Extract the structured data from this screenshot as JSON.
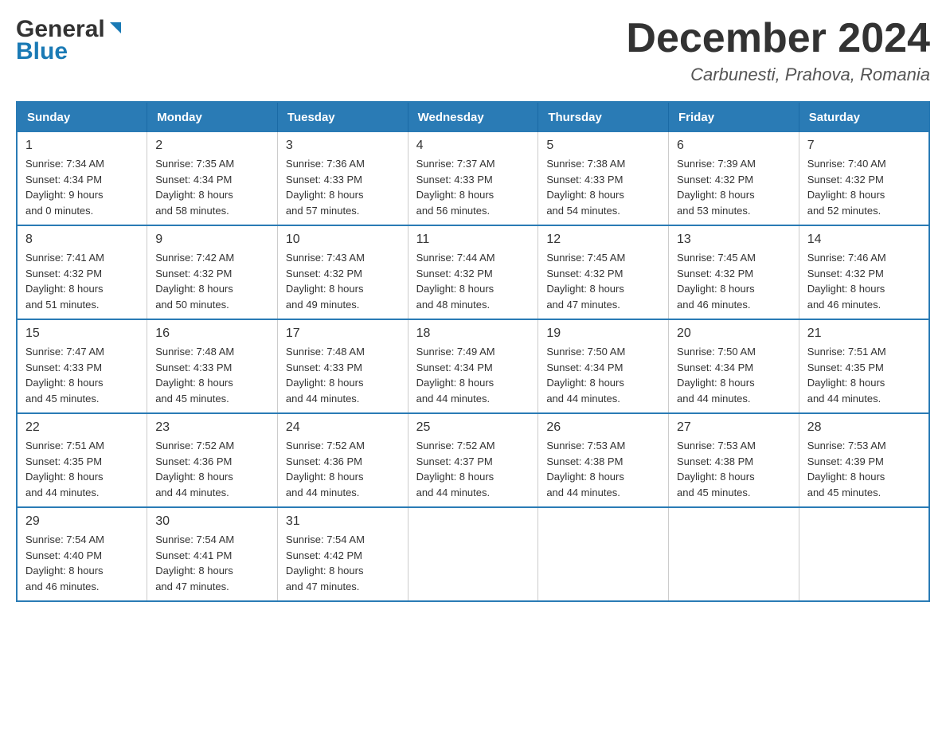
{
  "header": {
    "logo_general": "General",
    "logo_blue": "Blue",
    "month_title": "December 2024",
    "location": "Carbunesti, Prahova, Romania"
  },
  "days_of_week": [
    "Sunday",
    "Monday",
    "Tuesday",
    "Wednesday",
    "Thursday",
    "Friday",
    "Saturday"
  ],
  "weeks": [
    [
      {
        "day": "1",
        "sunrise": "Sunrise: 7:34 AM",
        "sunset": "Sunset: 4:34 PM",
        "daylight": "Daylight: 9 hours",
        "daylight2": "and 0 minutes."
      },
      {
        "day": "2",
        "sunrise": "Sunrise: 7:35 AM",
        "sunset": "Sunset: 4:34 PM",
        "daylight": "Daylight: 8 hours",
        "daylight2": "and 58 minutes."
      },
      {
        "day": "3",
        "sunrise": "Sunrise: 7:36 AM",
        "sunset": "Sunset: 4:33 PM",
        "daylight": "Daylight: 8 hours",
        "daylight2": "and 57 minutes."
      },
      {
        "day": "4",
        "sunrise": "Sunrise: 7:37 AM",
        "sunset": "Sunset: 4:33 PM",
        "daylight": "Daylight: 8 hours",
        "daylight2": "and 56 minutes."
      },
      {
        "day": "5",
        "sunrise": "Sunrise: 7:38 AM",
        "sunset": "Sunset: 4:33 PM",
        "daylight": "Daylight: 8 hours",
        "daylight2": "and 54 minutes."
      },
      {
        "day": "6",
        "sunrise": "Sunrise: 7:39 AM",
        "sunset": "Sunset: 4:32 PM",
        "daylight": "Daylight: 8 hours",
        "daylight2": "and 53 minutes."
      },
      {
        "day": "7",
        "sunrise": "Sunrise: 7:40 AM",
        "sunset": "Sunset: 4:32 PM",
        "daylight": "Daylight: 8 hours",
        "daylight2": "and 52 minutes."
      }
    ],
    [
      {
        "day": "8",
        "sunrise": "Sunrise: 7:41 AM",
        "sunset": "Sunset: 4:32 PM",
        "daylight": "Daylight: 8 hours",
        "daylight2": "and 51 minutes."
      },
      {
        "day": "9",
        "sunrise": "Sunrise: 7:42 AM",
        "sunset": "Sunset: 4:32 PM",
        "daylight": "Daylight: 8 hours",
        "daylight2": "and 50 minutes."
      },
      {
        "day": "10",
        "sunrise": "Sunrise: 7:43 AM",
        "sunset": "Sunset: 4:32 PM",
        "daylight": "Daylight: 8 hours",
        "daylight2": "and 49 minutes."
      },
      {
        "day": "11",
        "sunrise": "Sunrise: 7:44 AM",
        "sunset": "Sunset: 4:32 PM",
        "daylight": "Daylight: 8 hours",
        "daylight2": "and 48 minutes."
      },
      {
        "day": "12",
        "sunrise": "Sunrise: 7:45 AM",
        "sunset": "Sunset: 4:32 PM",
        "daylight": "Daylight: 8 hours",
        "daylight2": "and 47 minutes."
      },
      {
        "day": "13",
        "sunrise": "Sunrise: 7:45 AM",
        "sunset": "Sunset: 4:32 PM",
        "daylight": "Daylight: 8 hours",
        "daylight2": "and 46 minutes."
      },
      {
        "day": "14",
        "sunrise": "Sunrise: 7:46 AM",
        "sunset": "Sunset: 4:32 PM",
        "daylight": "Daylight: 8 hours",
        "daylight2": "and 46 minutes."
      }
    ],
    [
      {
        "day": "15",
        "sunrise": "Sunrise: 7:47 AM",
        "sunset": "Sunset: 4:33 PM",
        "daylight": "Daylight: 8 hours",
        "daylight2": "and 45 minutes."
      },
      {
        "day": "16",
        "sunrise": "Sunrise: 7:48 AM",
        "sunset": "Sunset: 4:33 PM",
        "daylight": "Daylight: 8 hours",
        "daylight2": "and 45 minutes."
      },
      {
        "day": "17",
        "sunrise": "Sunrise: 7:48 AM",
        "sunset": "Sunset: 4:33 PM",
        "daylight": "Daylight: 8 hours",
        "daylight2": "and 44 minutes."
      },
      {
        "day": "18",
        "sunrise": "Sunrise: 7:49 AM",
        "sunset": "Sunset: 4:34 PM",
        "daylight": "Daylight: 8 hours",
        "daylight2": "and 44 minutes."
      },
      {
        "day": "19",
        "sunrise": "Sunrise: 7:50 AM",
        "sunset": "Sunset: 4:34 PM",
        "daylight": "Daylight: 8 hours",
        "daylight2": "and 44 minutes."
      },
      {
        "day": "20",
        "sunrise": "Sunrise: 7:50 AM",
        "sunset": "Sunset: 4:34 PM",
        "daylight": "Daylight: 8 hours",
        "daylight2": "and 44 minutes."
      },
      {
        "day": "21",
        "sunrise": "Sunrise: 7:51 AM",
        "sunset": "Sunset: 4:35 PM",
        "daylight": "Daylight: 8 hours",
        "daylight2": "and 44 minutes."
      }
    ],
    [
      {
        "day": "22",
        "sunrise": "Sunrise: 7:51 AM",
        "sunset": "Sunset: 4:35 PM",
        "daylight": "Daylight: 8 hours",
        "daylight2": "and 44 minutes."
      },
      {
        "day": "23",
        "sunrise": "Sunrise: 7:52 AM",
        "sunset": "Sunset: 4:36 PM",
        "daylight": "Daylight: 8 hours",
        "daylight2": "and 44 minutes."
      },
      {
        "day": "24",
        "sunrise": "Sunrise: 7:52 AM",
        "sunset": "Sunset: 4:36 PM",
        "daylight": "Daylight: 8 hours",
        "daylight2": "and 44 minutes."
      },
      {
        "day": "25",
        "sunrise": "Sunrise: 7:52 AM",
        "sunset": "Sunset: 4:37 PM",
        "daylight": "Daylight: 8 hours",
        "daylight2": "and 44 minutes."
      },
      {
        "day": "26",
        "sunrise": "Sunrise: 7:53 AM",
        "sunset": "Sunset: 4:38 PM",
        "daylight": "Daylight: 8 hours",
        "daylight2": "and 44 minutes."
      },
      {
        "day": "27",
        "sunrise": "Sunrise: 7:53 AM",
        "sunset": "Sunset: 4:38 PM",
        "daylight": "Daylight: 8 hours",
        "daylight2": "and 45 minutes."
      },
      {
        "day": "28",
        "sunrise": "Sunrise: 7:53 AM",
        "sunset": "Sunset: 4:39 PM",
        "daylight": "Daylight: 8 hours",
        "daylight2": "and 45 minutes."
      }
    ],
    [
      {
        "day": "29",
        "sunrise": "Sunrise: 7:54 AM",
        "sunset": "Sunset: 4:40 PM",
        "daylight": "Daylight: 8 hours",
        "daylight2": "and 46 minutes."
      },
      {
        "day": "30",
        "sunrise": "Sunrise: 7:54 AM",
        "sunset": "Sunset: 4:41 PM",
        "daylight": "Daylight: 8 hours",
        "daylight2": "and 47 minutes."
      },
      {
        "day": "31",
        "sunrise": "Sunrise: 7:54 AM",
        "sunset": "Sunset: 4:42 PM",
        "daylight": "Daylight: 8 hours",
        "daylight2": "and 47 minutes."
      },
      {
        "day": "",
        "sunrise": "",
        "sunset": "",
        "daylight": "",
        "daylight2": ""
      },
      {
        "day": "",
        "sunrise": "",
        "sunset": "",
        "daylight": "",
        "daylight2": ""
      },
      {
        "day": "",
        "sunrise": "",
        "sunset": "",
        "daylight": "",
        "daylight2": ""
      },
      {
        "day": "",
        "sunrise": "",
        "sunset": "",
        "daylight": "",
        "daylight2": ""
      }
    ]
  ]
}
